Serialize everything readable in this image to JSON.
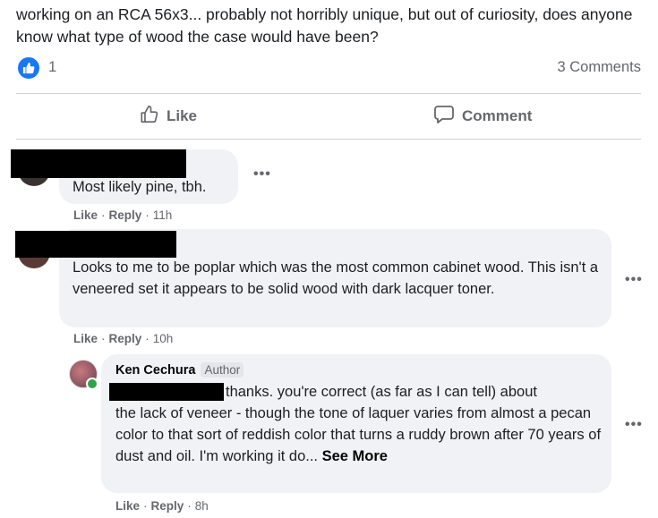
{
  "post": {
    "text": "working on an RCA 56x3...  probably not horribly unique, but out of curiosity, does anyone know what type of wood the case would have been?",
    "reaction_count": "1",
    "comments_count": "3 Comments"
  },
  "actions": {
    "like_label": "Like",
    "comment_label": "Comment"
  },
  "comments": [
    {
      "text": "Most likely pine, tbh.",
      "like": "Like",
      "reply": "Reply",
      "time": "11h"
    },
    {
      "text": "Looks to me to be poplar which was the most common cabinet wood. This isn't a veneered set it appears to be solid wood with dark lacquer toner.",
      "like": "Like",
      "reply": "Reply",
      "time": "10h"
    },
    {
      "author": "Ken Cechura",
      "badge": "Author",
      "text_line1": "thanks. you're correct (as far as I can tell) about",
      "text_rest": "the lack of veneer - though the tone of laquer varies from almost a pecan color to that sort of reddish color that turns a ruddy brown after 70 years of dust and oil. I'm working it do...",
      "see_more": "See More",
      "like": "Like",
      "reply": "Reply",
      "time": "8h"
    }
  ],
  "colors": {
    "accent": "#1877f2",
    "bubble": "#f0f2f5",
    "meta_text": "#65676b",
    "online": "#31a24c"
  },
  "icons": [
    "thumbs-up-icon",
    "like-outline-icon",
    "comment-icon",
    "more-dots-icon"
  ]
}
